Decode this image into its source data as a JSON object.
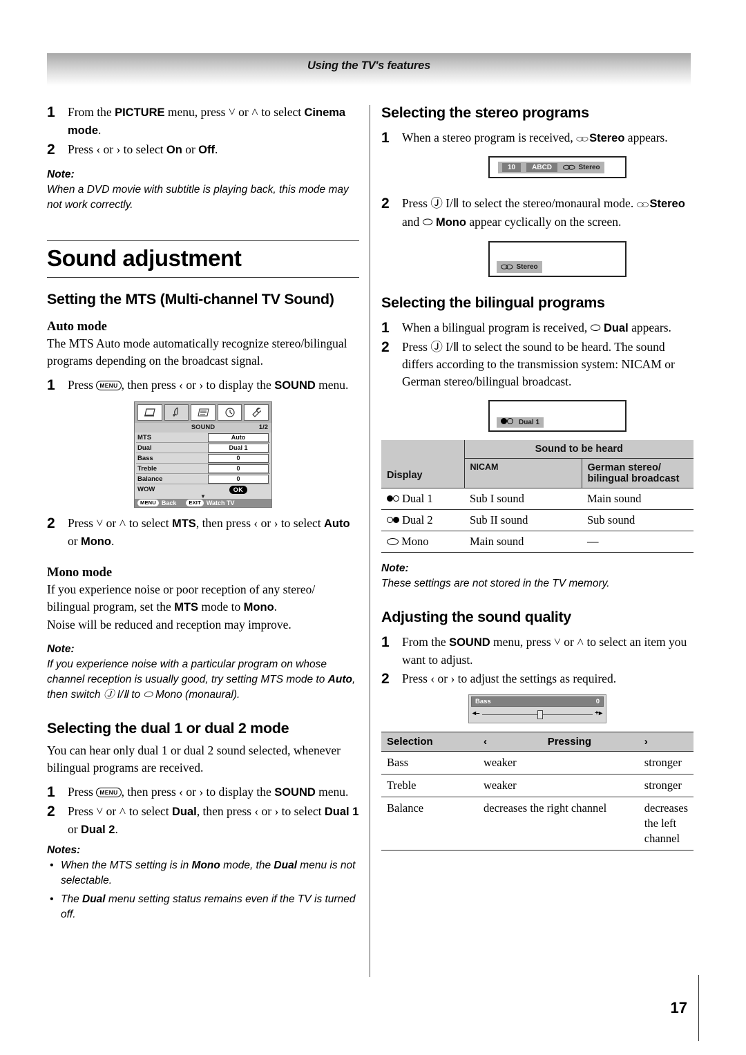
{
  "header": {
    "title": "Using the TV's features"
  },
  "page_number": "17",
  "left": {
    "steps_top": [
      {
        "num": "1",
        "html": "From the <b>PICTURE</b> menu, press ˅ or ˄ to select <b>Cinema mode</b>."
      },
      {
        "num": "2",
        "html": "Press ‹ or › to select <b>On</b> or <b>Off</b>."
      }
    ],
    "note1_label": "Note:",
    "note1_body": "When a DVD movie with subtitle is playing back, this mode may not work correctly.",
    "section_title": "Sound adjustment",
    "mts_heading": "Setting the MTS (Multi-channel TV Sound)",
    "auto_mode_heading": "Auto mode",
    "auto_mode_body": "The MTS Auto mode automatically recognize stereo/bilingual programs depending on the broadcast signal.",
    "step_menu_1": {
      "num": "1",
      "html": "Press <span class=\"key-menu\">MENU</span>, then press ‹ or › to display the <b>SOUND</b> menu."
    },
    "step_mts_2": {
      "num": "2",
      "html": "Press ˅ or ˄ to select <b>MTS</b>, then press ‹ or › to select <b>Auto</b> or <b>Mono</b>."
    },
    "mono_mode_heading": "Mono mode",
    "mono_mode_body": "If you experience noise or poor reception of any stereo/ bilingual program, set the <b>MTS</b> mode to <b>Mono</b>.<br>Noise will be reduced and reception may improve.",
    "note2_label": "Note:",
    "note2_body": "If you experience noise with a particular program on whose channel reception is usually good, try setting MTS mode to <b>Auto</b>, then switch Ⓙ I/Ⅱ to ⬭ Mono (monaural).",
    "dual_heading": "Selecting the dual 1 or dual 2 mode",
    "dual_body": "You can hear only dual 1 or dual 2 sound selected, whenever bilingual programs are received.",
    "dual_step_1": {
      "num": "1",
      "html": "Press <span class=\"key-menu\">MENU</span>, then press ‹ or › to display the <b>SOUND</b> menu."
    },
    "dual_step_2": {
      "num": "2",
      "html": "Press ˅ or ˄ to select <b>Dual</b>, then press ‹ or › to select <b>Dual 1</b> or <b>Dual 2</b>."
    },
    "notes_label": "Notes:",
    "notes_items": [
      "When the MTS setting is in <b>Mono</b> mode, the <b>Dual</b> menu is not selectable.",
      "The <b>Dual</b> menu setting status remains even if the TV is turned off."
    ]
  },
  "sound_menu": {
    "title": "SOUND",
    "page_indicator": "1/2",
    "icons": [
      "picture-icon",
      "music-note-icon",
      "features-icon",
      "clock-icon",
      "setup-icon"
    ],
    "active_icon_index": 1,
    "rows": [
      {
        "label": "MTS",
        "value": "Auto"
      },
      {
        "label": "Dual",
        "value": "Dual 1"
      },
      {
        "label": "Bass",
        "value": "0"
      },
      {
        "label": "Treble",
        "value": "0"
      },
      {
        "label": "Balance",
        "value": "0"
      },
      {
        "label": "WOW",
        "value": "OK"
      }
    ],
    "footer": [
      {
        "key": "MENU",
        "label": "Back"
      },
      {
        "key": "EXIT",
        "label": "Watch TV"
      }
    ]
  },
  "right": {
    "stereo_heading": "Selecting the stereo programs",
    "stereo_step_1": {
      "num": "1",
      "html": "When a stereo program is received, <span class=\"glyph-stereo\">⬭⬭</span> <b>Stereo</b> appears."
    },
    "osd_stereo_channel": "10",
    "osd_stereo_name": "ABCD",
    "osd_stereo_label": "Stereo",
    "stereo_step_2": {
      "num": "2",
      "html": "Press Ⓙ I/Ⅱ to select the stereo/monaural mode. <span class=\"glyph-stereo\">⬭⬭</span> <b>Stereo</b> and ⬭ <b>Mono</b> appear cyclically on the screen."
    },
    "osd_stereo_only_label": "Stereo",
    "bilingual_heading": "Selecting the bilingual programs",
    "bilingual_step_1": {
      "num": "1",
      "html": "When a bilingual program is received, ⬭ <b>Dual</b> appears."
    },
    "bilingual_step_2": {
      "num": "2",
      "html": "Press Ⓙ I/Ⅱ to select the sound to be heard. The sound differs according to the transmission system: NICAM or German stereo/bilingual broadcast."
    },
    "osd_dual_label": "Dual  1",
    "note_label": "Note:",
    "note_body": "These settings are not stored in the TV memory.",
    "sound_quality_heading": "Adjusting the sound quality",
    "sq_step_1": {
      "num": "1",
      "html": "From the <b>SOUND</b> menu, press ˅ or ˄ to select an item you want to adjust."
    },
    "sq_step_2": {
      "num": "2",
      "html": "Press ‹ or › to adjust the settings as required."
    }
  },
  "bass_slider": {
    "label": "Bass",
    "value": "0",
    "minus": "◂–",
    "plus": "+▸"
  },
  "sound_table": {
    "col_display": "Display",
    "col_group": "Sound to be heard",
    "col_nicam": "NICAM",
    "col_german": "German stereo/\nbilingual broadcast",
    "rows": [
      {
        "display": "Dual 1",
        "marker": "filled-empty",
        "nicam": "Sub I sound",
        "german": "Main sound"
      },
      {
        "display": "Dual 2",
        "marker": "empty-filled",
        "nicam": "Sub II sound",
        "german": "Sub sound"
      },
      {
        "display": "Mono",
        "marker": "ellipse",
        "nicam": "Main sound",
        "german": "—"
      }
    ]
  },
  "selection_table": {
    "headers": [
      "Selection",
      "‹",
      "Pressing",
      "›"
    ],
    "rows": [
      {
        "selection": "Bass",
        "left": "weaker",
        "right": "stronger"
      },
      {
        "selection": "Treble",
        "left": "weaker",
        "right": "stronger"
      },
      {
        "selection": "Balance",
        "left": "decreases the right channel",
        "right": "decreases the left channel"
      }
    ]
  }
}
